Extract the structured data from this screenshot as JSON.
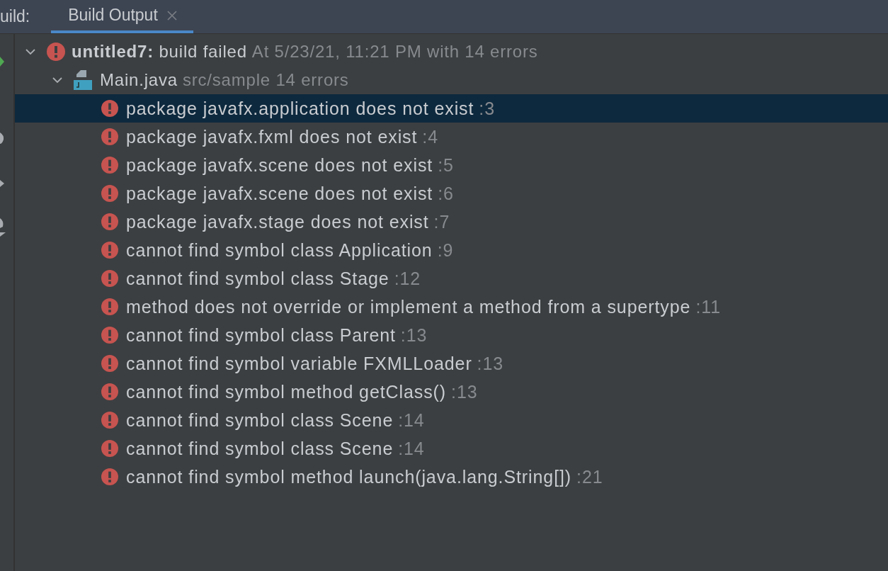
{
  "header": {
    "label": "uild:",
    "tabs": [
      {
        "label": "Build Output",
        "selected": true,
        "closable": true
      }
    ]
  },
  "tree": [
    {
      "kind": "build",
      "expanded": true,
      "title": "untitled7:",
      "status": "build failed",
      "detail": "At 5/23/21, 11:21 PM with 14 errors",
      "children": [
        {
          "kind": "file",
          "expanded": true,
          "name": "Main.java",
          "detail": "src/sample 14 errors",
          "children": [
            {
              "kind": "error",
              "message": "package javafx.application does not exist",
              "line": ":3",
              "selected": true
            },
            {
              "kind": "error",
              "message": "package javafx.fxml does not exist",
              "line": ":4",
              "selected": false
            },
            {
              "kind": "error",
              "message": "package javafx.scene does not exist",
              "line": ":5",
              "selected": false
            },
            {
              "kind": "error",
              "message": "package javafx.scene does not exist",
              "line": ":6",
              "selected": false
            },
            {
              "kind": "error",
              "message": "package javafx.stage does not exist",
              "line": ":7",
              "selected": false
            },
            {
              "kind": "error",
              "message": "cannot find symbol class Application",
              "line": ":9",
              "selected": false
            },
            {
              "kind": "error",
              "message": "cannot find symbol class Stage",
              "line": ":12",
              "selected": false
            },
            {
              "kind": "error",
              "message": "method does not override or implement a method from a supertype",
              "line": ":11",
              "selected": false
            },
            {
              "kind": "error",
              "message": "cannot find symbol class Parent",
              "line": ":13",
              "selected": false
            },
            {
              "kind": "error",
              "message": "cannot find symbol variable FXMLLoader",
              "line": ":13",
              "selected": false
            },
            {
              "kind": "error",
              "message": "cannot find symbol method getClass()",
              "line": ":13",
              "selected": false
            },
            {
              "kind": "error",
              "message": "cannot find symbol class Scene",
              "line": ":14",
              "selected": false
            },
            {
              "kind": "error",
              "message": "cannot find symbol class Scene",
              "line": ":14",
              "selected": false
            },
            {
              "kind": "error",
              "message": "cannot find symbol method launch(java.lang.String[])",
              "line": ":21",
              "selected": false
            }
          ]
        }
      ]
    }
  ]
}
